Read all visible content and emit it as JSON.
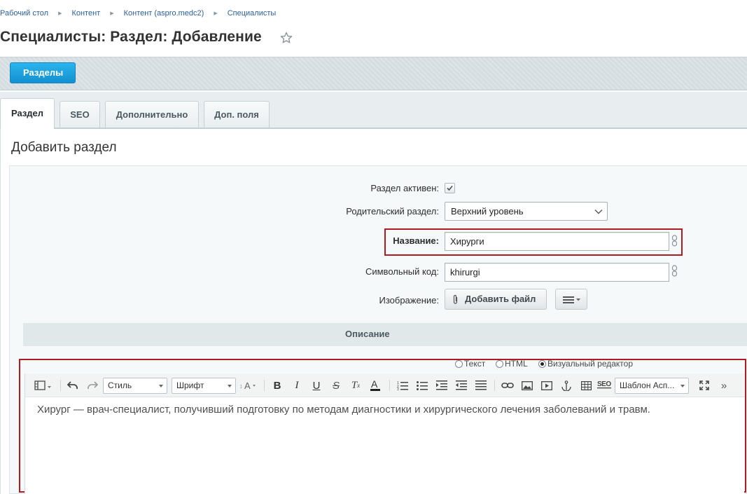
{
  "breadcrumb": [
    "Рабочий стол",
    "Контент",
    "Контент (aspro.medc2)",
    "Специалисты"
  ],
  "page_title": "Специалисты: Раздел: Добавление",
  "toolbar": {
    "sections_button": "Разделы"
  },
  "tabs": [
    "Раздел",
    "SEO",
    "Дополнительно",
    "Доп. поля"
  ],
  "active_tab": "Раздел",
  "section_title": "Добавить раздел",
  "form": {
    "active_label": "Раздел активен:",
    "active_checked": true,
    "parent_label": "Родительский раздел:",
    "parent_value": "Верхний уровень",
    "name_label": "Название:",
    "name_value": "Хирурги",
    "code_label": "Символьный код:",
    "code_value": "khirurgi",
    "image_label": "Изображение:",
    "add_file_button": "Добавить файл"
  },
  "description": {
    "header": "Описание",
    "modes": [
      "Текст",
      "HTML",
      "Визуальный редактор"
    ],
    "selected_mode": "Визуальный редактор",
    "style_select": "Стиль",
    "font_select": "Шрифт",
    "template_select": "Шаблон Асп...",
    "content": "Хирург  — врач-специалист, получивший подготовку по методам диагностики и хирургического лечения заболеваний и травм."
  },
  "colors": {
    "highlight": "#b01a22",
    "button_blue": "#1a9ad9"
  },
  "icons": [
    "star-icon",
    "chevron-down-icon",
    "link-icon",
    "paperclip-icon",
    "menu-icon",
    "undo-icon",
    "redo-icon",
    "bold-icon",
    "italic-icon",
    "underline-icon",
    "strikethrough-icon",
    "clear-format-icon",
    "text-color-icon",
    "ordered-list-icon",
    "unordered-list-icon",
    "indent-icon",
    "outdent-icon",
    "align-icon",
    "hyperlink-icon",
    "image-icon",
    "video-icon",
    "anchor-icon",
    "table-icon",
    "seo-icon",
    "fullscreen-icon",
    "more-icon"
  ]
}
